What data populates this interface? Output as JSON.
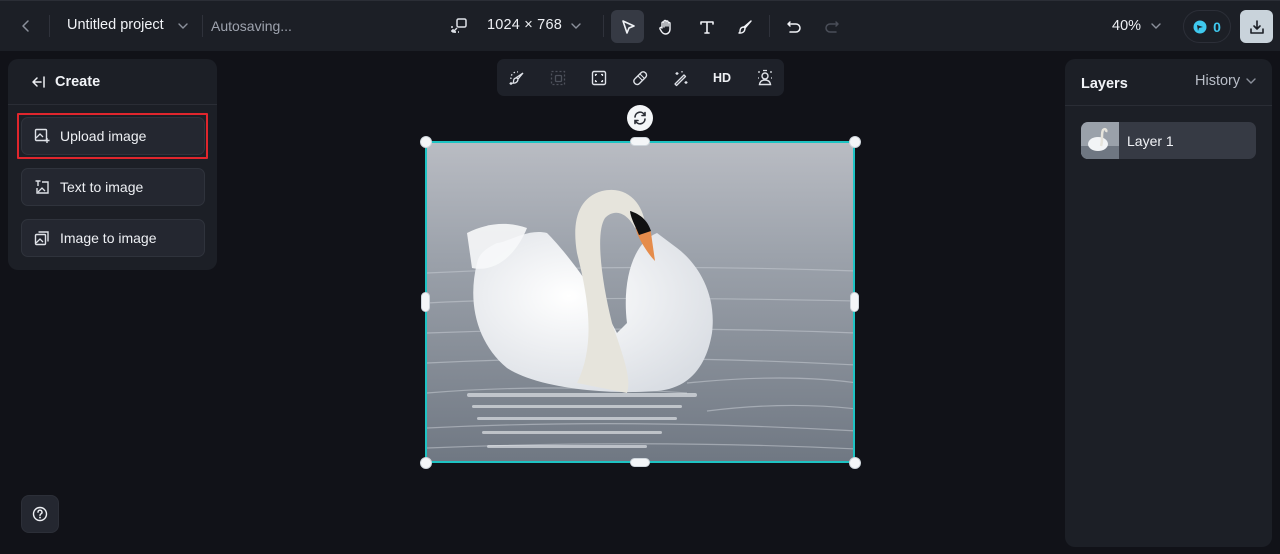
{
  "topbar": {
    "back_icon": "chevron-left-icon",
    "project_title": "Untitled project",
    "status": "Autosaving...",
    "canvas_size": "1024 × 768",
    "tools": [
      {
        "name": "select",
        "icon": "cursor-arrow-icon",
        "active": true
      },
      {
        "name": "hand",
        "icon": "hand-icon",
        "active": false
      },
      {
        "name": "text",
        "icon": "text-icon",
        "active": false
      },
      {
        "name": "brush",
        "icon": "brush-icon",
        "active": false
      }
    ],
    "undo_icon": "undo-icon",
    "redo_icon": "redo-icon",
    "zoom_level": "40%",
    "credits": "0",
    "download_icon": "download-icon"
  },
  "create_panel": {
    "title": "Create",
    "options": [
      {
        "label": "Upload image",
        "icon": "upload-image-icon",
        "highlighted": true
      },
      {
        "label": "Text to image",
        "icon": "text-to-image-icon",
        "highlighted": false
      },
      {
        "label": "Image to image",
        "icon": "image-to-image-icon",
        "highlighted": false
      }
    ]
  },
  "context_toolbar": {
    "tools": [
      {
        "name": "inpaint",
        "icon": "magic-brush-icon"
      },
      {
        "name": "expand",
        "icon": "expand-frame-icon",
        "disabled": true
      },
      {
        "name": "crop",
        "icon": "crop-frame-icon"
      },
      {
        "name": "eraser",
        "icon": "eraser-icon"
      },
      {
        "name": "magic-wand",
        "icon": "magic-wand-icon"
      },
      {
        "name": "upscale",
        "label": "HD"
      },
      {
        "name": "remove-background",
        "icon": "person-cutout-icon"
      }
    ]
  },
  "canvas": {
    "image_subject": "White swan on water",
    "selection_color": "#1ec3c3"
  },
  "layers_panel": {
    "title": "Layers",
    "history_tab": "History",
    "layers": [
      {
        "name": "Layer 1"
      }
    ]
  },
  "help_icon": "help-circle-icon"
}
